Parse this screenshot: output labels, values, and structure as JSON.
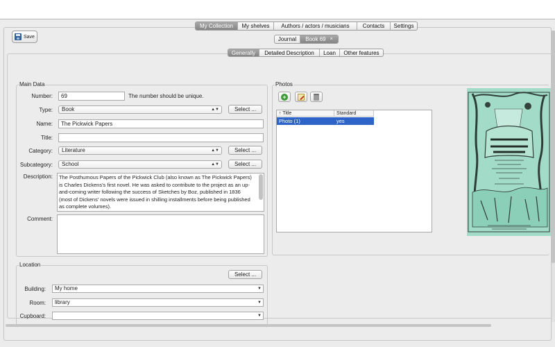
{
  "main_tabs": [
    "My Collection",
    "My shelves",
    "Authors / actors / musicians",
    "Contacts",
    "Settings"
  ],
  "doc_tabs": {
    "journal": "Journal",
    "book": "Book 69",
    "close": "×"
  },
  "toolbar": {
    "save_label": "Save"
  },
  "inner_tabs": [
    "Generally",
    "Detailed Description",
    "Loan",
    "Other features"
  ],
  "main_data": {
    "title": "Main Data",
    "number_label": "Number:",
    "number_value": "69",
    "number_hint": "The number should be unique.",
    "type_label": "Type:",
    "type_value": "Book",
    "name_label": "Name:",
    "name_value": "The Pickwick Papers",
    "title_label": "Title:",
    "title_value": "",
    "category_label": "Category:",
    "category_value": "Literature",
    "subcategory_label": "Subcategory:",
    "subcategory_value": "School",
    "description_label": "Description:",
    "description_value": "The Posthumous Papers of the Pickwick Club (also known as The Pickwick Papers) is Charles Dickens's first novel. He was asked to contribute to the project as an up-and-coming writer following the success of Sketches by Boz, published in 1836 (most of Dickens' novels were issued in shilling installments before being published as complete volumes).",
    "comment_label": "Comment:",
    "comment_value": "",
    "select_label": "Select ..."
  },
  "location": {
    "title": "Location",
    "select_label": "Select ...",
    "building_label": "Building:",
    "building_value": "My home",
    "room_label": "Room:",
    "room_value": "library",
    "cupboard_label": "Cupboard:",
    "cupboard_value": ""
  },
  "photos": {
    "title": "Photos",
    "col_title": "Title",
    "col_standard": "Standard",
    "sort_glyph": "↑",
    "rows": [
      {
        "title": "Photo (1)",
        "standard": "yes"
      }
    ]
  },
  "icons": {
    "save": "floppy-disk-icon",
    "add": "add-photo-icon",
    "edit": "edit-photo-icon",
    "delete": "trash-icon"
  },
  "colors": {
    "selection": "#2e63c7",
    "cover_background": "#9fd9c6",
    "active_tab": "#8f8f8f"
  }
}
